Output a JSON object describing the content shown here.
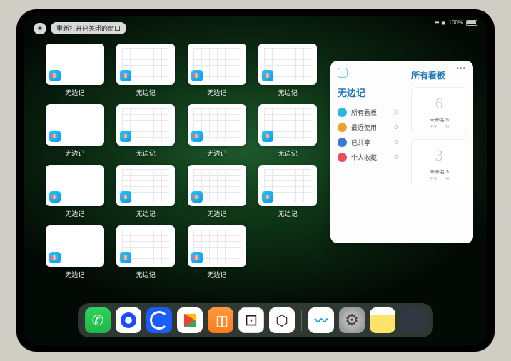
{
  "statusbar": {
    "battery_pct": "100%"
  },
  "topleft": {
    "plus": "+",
    "reopen_label": "重新打开已关闭的窗口"
  },
  "app_label": "无边记",
  "windows": [
    {
      "variant": "blank"
    },
    {
      "variant": "cal"
    },
    {
      "variant": "cal"
    },
    {
      "variant": "cal"
    },
    {
      "variant": "blank"
    },
    {
      "variant": "cal"
    },
    {
      "variant": "cal"
    },
    {
      "variant": "cal"
    },
    {
      "variant": "blank"
    },
    {
      "variant": "cal"
    },
    {
      "variant": "cal"
    },
    {
      "variant": "cal"
    },
    {
      "variant": "blank"
    },
    {
      "variant": "cal"
    },
    {
      "variant": "cal"
    }
  ],
  "panel": {
    "left_title": "无边记",
    "right_title": "所有看板",
    "menu": "•••",
    "items": [
      {
        "label": "所有看板",
        "count": "0"
      },
      {
        "label": "最近使用",
        "count": "0"
      },
      {
        "label": "已共享",
        "count": "0"
      },
      {
        "label": "个人收藏",
        "count": "0"
      }
    ],
    "boards": [
      {
        "sketch": "6",
        "name": "未命名 6",
        "time": "下午 11:39"
      },
      {
        "sketch": "3",
        "name": "未命名 3",
        "time": "下午 11:38"
      }
    ]
  },
  "dock": {
    "icons": [
      {
        "name": "wechat-icon"
      },
      {
        "name": "browser1-icon"
      },
      {
        "name": "browser2-icon"
      },
      {
        "name": "play-icon"
      },
      {
        "name": "books-icon"
      },
      {
        "name": "dice-icon"
      },
      {
        "name": "hex-icon"
      },
      {
        "name": "freeform-icon"
      },
      {
        "name": "settings-icon"
      },
      {
        "name": "notes-icon"
      },
      {
        "name": "app-library-icon"
      }
    ]
  }
}
